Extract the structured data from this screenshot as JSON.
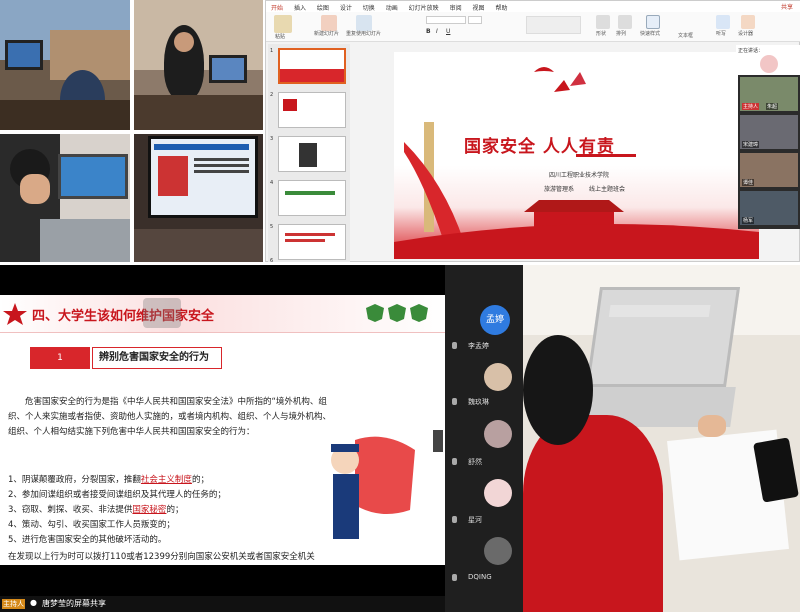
{
  "ppt": {
    "tabs": [
      "开始",
      "插入",
      "绘图",
      "设计",
      "切换",
      "动画",
      "幻灯片放映",
      "审阅",
      "视图",
      "帮助"
    ],
    "active_tab": "开始",
    "share_label": "共享",
    "ribbon_labels": [
      "粘贴",
      "新建幻灯片",
      "重复使用幻灯片",
      "形状",
      "排列",
      "快速样式",
      "听写",
      "设计器",
      "文本框"
    ],
    "slide_numbers": [
      "1",
      "2",
      "3",
      "4",
      "5",
      "6"
    ],
    "slide": {
      "title": "国家安全 人人有责",
      "school": "四川工程职业技术学院",
      "dept": "旅游管理系",
      "meeting": "线上主题班会"
    },
    "meeting_panel": {
      "header": "正在讲话：",
      "participants": [
        "主持人",
        "朱超",
        "宋建璋",
        "谭佳",
        "杨军"
      ]
    }
  },
  "lesson": {
    "section_title": "四、大学生该如何维护国家安全",
    "box_number": "1",
    "box_title": "辨别危害国家安全的行为",
    "paragraph": "危害国家安全的行为是指《中华人民共和国国家安全法》中所指的“境外机构、组织、个人来实施或者指使、资助他人实施的，或者境内机构、组织、个人与境外机构、组织、个人相勾结实施下列危害中华人民共和国国家安全的行为：",
    "items": [
      "1、阴谋颠覆政府，分裂国家，推翻",
      "2、参加间谍组织或者接受间谍组织及其代理人的任务的；",
      "3、窃取、刺探、收买、非法提供",
      "4、策动、勾引、收买国家工作人员叛变的；",
      "5、进行危害国家安全的其他破坏活动的。"
    ],
    "item1_highlight": "社会主义制度",
    "item1_tail": "的；",
    "item3_highlight": "国家秘密",
    "item3_tail": "的；",
    "footer": "在发现以上行为时可以拨打110或者12399分别向国家公安机关或者国家安全机关进行举报。",
    "screen_share_label": "唐梦莹的屏幕共享",
    "host_badge": "主持人",
    "participants": [
      {
        "name": "孟婷",
        "avatar": "孟婷"
      },
      {
        "name": "李孟婷"
      },
      {
        "name": "魏玖琳"
      },
      {
        "name": "舒然"
      },
      {
        "name": "星河"
      },
      {
        "name": "DQING"
      }
    ]
  },
  "colors": {
    "brand_red": "#c8161d",
    "ppt_accent": "#c0392b",
    "orange": "#e06020"
  }
}
